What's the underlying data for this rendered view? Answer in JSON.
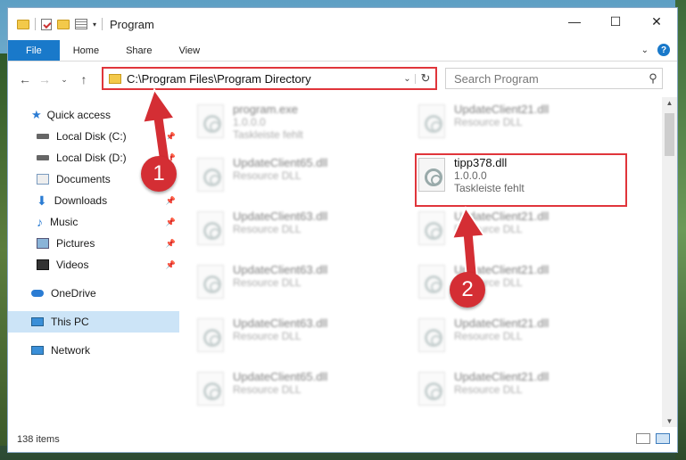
{
  "window": {
    "title": "Program",
    "controls": {
      "minimize": "—",
      "maximize": "☐",
      "close": "✕"
    }
  },
  "ribbon": {
    "tabs": [
      "File",
      "Home",
      "Share",
      "View"
    ],
    "help": "?"
  },
  "address": {
    "path": "C:\\Program Files\\Program Directory",
    "search_placeholder": "Search Program"
  },
  "nav": {
    "items": [
      {
        "label": "Quick access",
        "icon": "star-icon"
      },
      {
        "label": "Local Disk (C:)",
        "icon": "drive-icon",
        "pinned": true
      },
      {
        "label": "Local Disk (D:)",
        "icon": "drive-icon",
        "pinned": true
      },
      {
        "label": "Documents",
        "icon": "documents-icon",
        "pinned": true
      },
      {
        "label": "Downloads",
        "icon": "download-icon",
        "pinned": true
      },
      {
        "label": "Music",
        "icon": "music-icon",
        "pinned": true
      },
      {
        "label": "Pictures",
        "icon": "pictures-icon",
        "pinned": true
      },
      {
        "label": "Videos",
        "icon": "videos-icon",
        "pinned": true
      },
      {
        "label": "OneDrive",
        "icon": "cloud-icon"
      },
      {
        "label": "This PC",
        "icon": "computer-icon",
        "selected": true
      },
      {
        "label": "Network",
        "icon": "network-icon"
      }
    ]
  },
  "files": [
    {
      "name": "program.exe",
      "sub1": "1.0.0.0",
      "sub2": "Taskleiste fehlt"
    },
    {
      "name": "UpdateClient21.dll",
      "sub1": "Resource DLL"
    },
    {
      "name": "UpdateClient65.dll",
      "sub1": "Resource DLL"
    },
    {
      "name": "tipp378.dll",
      "sub1": "1.0.0.0",
      "sub2": "Taskleiste fehlt",
      "highlight": true
    },
    {
      "name": "UpdateClient63.dll",
      "sub1": "Resource DLL"
    },
    {
      "name": "UpdateClient21.dll",
      "sub1": "Resource DLL"
    },
    {
      "name": "UpdateClient63.dll",
      "sub1": "Resource DLL"
    },
    {
      "name": "UpdateClient21.dll",
      "sub1": "Resource DLL"
    },
    {
      "name": "UpdateClient63.dll",
      "sub1": "Resource DLL"
    },
    {
      "name": "UpdateClient21.dll",
      "sub1": "Resource DLL"
    },
    {
      "name": "UpdateClient65.dll",
      "sub1": "Resource DLL"
    },
    {
      "name": "UpdateClient21.dll",
      "sub1": "Resource DLL"
    }
  ],
  "status": {
    "item_count": "138 items"
  },
  "annotations": {
    "badge1": "1",
    "badge2": "2",
    "color": "#d42e34"
  }
}
